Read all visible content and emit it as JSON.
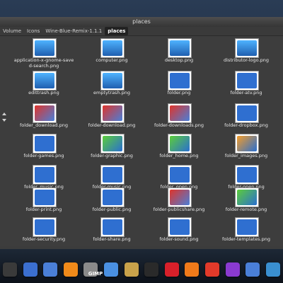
{
  "window": {
    "title": "places"
  },
  "breadcrumbs": [
    "Volume",
    "Icons",
    "Wine-Blue-Remix-1.1.1",
    "places"
  ],
  "files": [
    {
      "name": "application-x-gnome-saved-search.png",
      "style": "sky"
    },
    {
      "name": "computer.png",
      "style": "sky"
    },
    {
      "name": "desktop.png",
      "style": "sky"
    },
    {
      "name": "distributor-logo.png",
      "style": "sky"
    },
    {
      "name": "edittrash.png",
      "style": "sky"
    },
    {
      "name": "emptytrash.png",
      "style": "sky"
    },
    {
      "name": "folder.png",
      "style": ""
    },
    {
      "name": "folder-atv.png",
      "style": ""
    },
    {
      "name": "folder_download.png",
      "style": "red"
    },
    {
      "name": "folder-download.png",
      "style": "red"
    },
    {
      "name": "folder-downloads.png",
      "style": "red"
    },
    {
      "name": "folder-dropbox.png",
      "style": ""
    },
    {
      "name": "folder-games.png",
      "style": ""
    },
    {
      "name": "folder-graphic.png",
      "style": "green"
    },
    {
      "name": "folder_home.png",
      "style": "green"
    },
    {
      "name": "folder_images.png",
      "style": "orange"
    },
    {
      "name": "folder_music.png",
      "style": ""
    },
    {
      "name": "folder-music.png",
      "style": ""
    },
    {
      "name": "folder_open.png",
      "style": ""
    },
    {
      "name": "folder-open.png",
      "style": ""
    },
    {
      "name": "folder-print.png",
      "style": ""
    },
    {
      "name": "folder-public.png",
      "style": ""
    },
    {
      "name": "folder-publicshare.png",
      "style": "red"
    },
    {
      "name": "folder-remote.png",
      "style": "green"
    },
    {
      "name": "folder-security.png",
      "style": ""
    },
    {
      "name": "folder-share.png",
      "style": ""
    },
    {
      "name": "folder-sound.png",
      "style": ""
    },
    {
      "name": "folder-templates.png",
      "style": ""
    }
  ],
  "dock": {
    "gimp_label": "GIMP",
    "icon_names": [
      "terminal-icon",
      "music-icon",
      "photos-icon",
      "settings-icon",
      "gimp-icon",
      "files-icon",
      "image-viewer-icon",
      "video-icon",
      "opera-icon",
      "firefox-icon",
      "chrome-icon",
      "launcher-icon",
      "network-icon",
      "browser-icon"
    ],
    "icon_colors": [
      "#3a3a3a",
      "#3b6fd0",
      "#4a7fd8",
      "#f08a1a",
      "#8a8a8a",
      "#4a90e2",
      "#c9a24a",
      "#2a2a2a",
      "#d8202a",
      "#f07a1a",
      "#e23a2a",
      "#8a3ad0",
      "#4a7fd8",
      "#3a8fd0"
    ]
  }
}
